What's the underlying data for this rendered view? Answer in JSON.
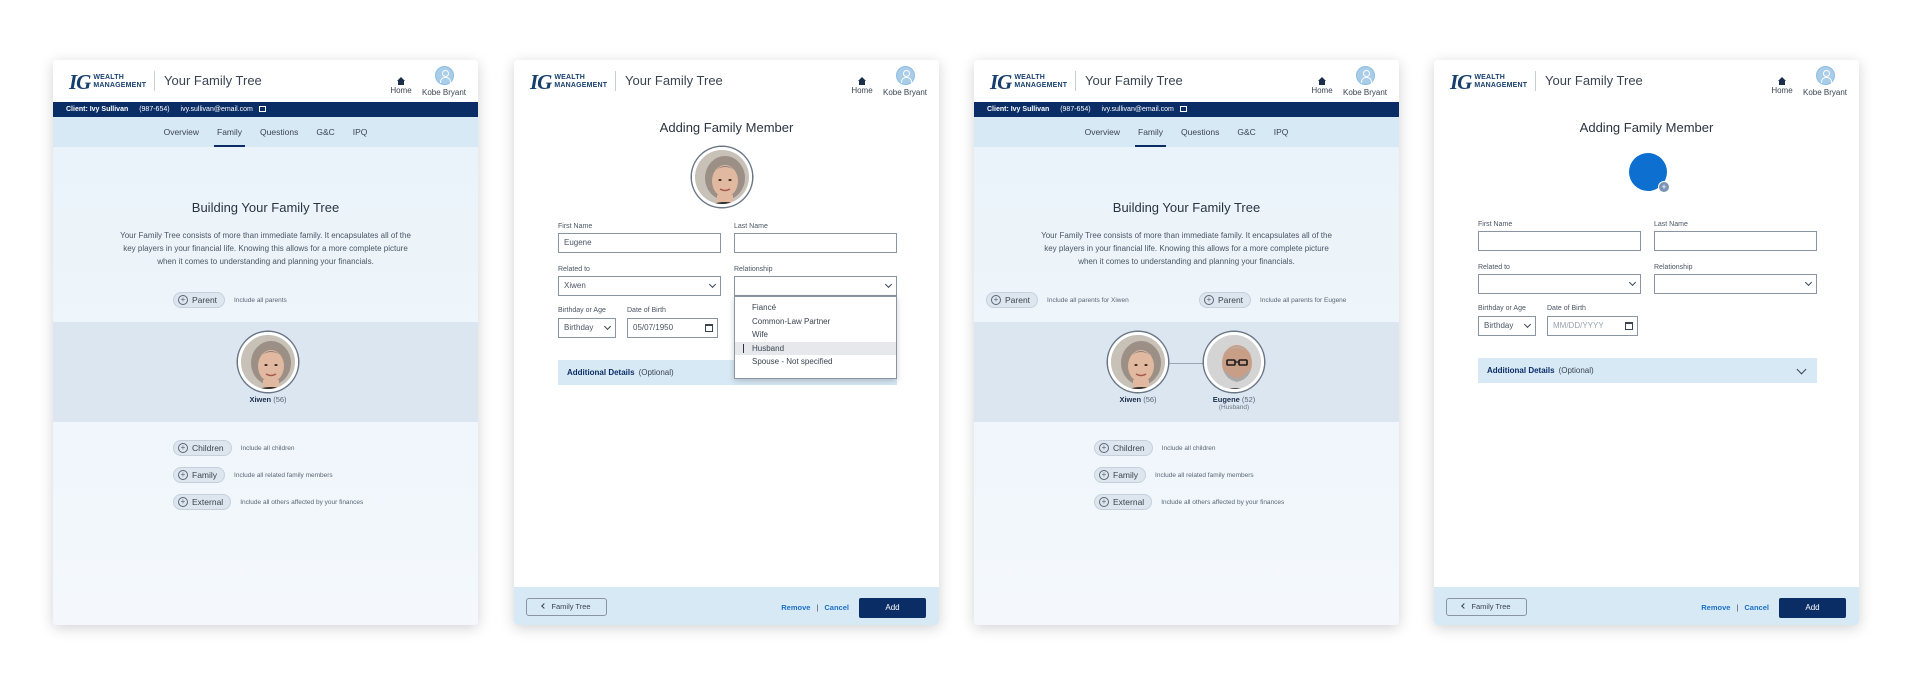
{
  "common": {
    "logo_mark": "IG",
    "logo_line1": "WEALTH",
    "logo_line2": "MANAGEMENT",
    "page_title": "Your Family Tree",
    "home_label": "Home",
    "user_name": "Kobe Bryant",
    "client_label": "Client: Ivy Sullivan",
    "client_phone": "(987-654)",
    "client_email": "ivy.sullivan@email.com",
    "nav_tabs": [
      "Overview",
      "Family",
      "Questions",
      "G&C",
      "IPQ"
    ],
    "nav_active": "Family",
    "building_title": "Building Your Family Tree",
    "building_desc": "Your Family Tree consists of more than immediate family. It encapsulates all of the key players in your financial life. Knowing this allows for a more complete picture when it comes to understanding and planning your financials.",
    "pill_parent": "Parent",
    "pill_children": "Children",
    "pill_family": "Family",
    "pill_external": "External",
    "note_children": "Include all children",
    "note_family": "Include all related family members",
    "note_external": "Include all others affected by your finances"
  },
  "screen1": {
    "note_parent": "Include all parents",
    "person": {
      "name": "Xiwen",
      "age": "(56)"
    }
  },
  "screen3": {
    "note_parent_left": "Include all parents for Xiwen",
    "note_parent_right": "Include all parents for Eugene",
    "persons": [
      {
        "name": "Xiwen",
        "age": "(56)",
        "sub": ""
      },
      {
        "name": "Eugene",
        "age": "(52)",
        "sub": "(Husband)"
      }
    ]
  },
  "form": {
    "title": "Adding Family Member",
    "first_name_label": "First Name",
    "last_name_label": "Last Name",
    "related_to_label": "Related to",
    "relationship_label": "Relationship",
    "birthday_or_age_label": "Birthday or Age",
    "dob_label": "Date of Birth",
    "additional_details": "Additional Details",
    "optional": "(Optional)",
    "back_label": "Family Tree",
    "remove_label": "Remove",
    "cancel_label": "Cancel",
    "add_label": "Add",
    "separator": "|"
  },
  "screen2": {
    "first_name_value": "Eugene",
    "related_to_value": "Xiwen",
    "birthday_type": "Birthday",
    "dob_value": "05/07/1950",
    "relationship_options": [
      "Fiancé",
      "Common-Law Partner",
      "Wife",
      "Husband",
      "Spouse - Not specified"
    ],
    "highlighted_option": "Husband"
  },
  "screen4": {
    "birthday_type": "Birthday",
    "dob_placeholder": "MM/DD/YYYY"
  },
  "colors": {
    "navy": "#0a2d66",
    "accent_blue": "#0d6fd0",
    "nav_bg": "#d8e9f6"
  }
}
